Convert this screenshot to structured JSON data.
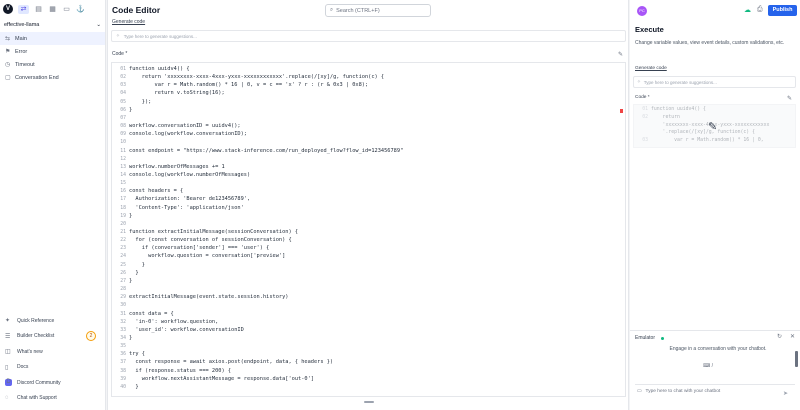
{
  "sidebar": {
    "logo": "V",
    "flow_name": "effective-llama",
    "flow_icon": "chevron-down-icon",
    "items": [
      {
        "label": "Main",
        "icon": "swap-icon",
        "active": true
      },
      {
        "label": "Error",
        "icon": "flag-icon",
        "active": false
      },
      {
        "label": "Timeout",
        "icon": "clock-icon",
        "active": false
      },
      {
        "label": "Conversation End",
        "icon": "stop-icon",
        "active": false
      }
    ],
    "bottom": [
      {
        "label": "Quick Reference",
        "icon": "lightbulb-icon"
      },
      {
        "label": "Builder Checklist",
        "icon": "checklist-icon",
        "badge": "2"
      },
      {
        "label": "What's new",
        "icon": "gift-icon"
      },
      {
        "label": "Docs",
        "icon": "book-icon"
      },
      {
        "label": "Discord Community",
        "icon": "discord-icon"
      },
      {
        "label": "Chat with Support",
        "icon": "chat-icon"
      }
    ]
  },
  "editor": {
    "title": "Code Editor",
    "search_placeholder": "Search (CTRL+F)",
    "generate_label": "Generate code",
    "generate_placeholder": "Type here to generate suggestions...",
    "code_label": "Code *",
    "lines": [
      {
        "n": "01",
        "t": "function uuidv4() {"
      },
      {
        "n": "02",
        "t": "    return 'xxxxxxxx-xxxx-4xxx-yxxx-xxxxxxxxxxxx'.replace(/[xy]/g, function(c) {"
      },
      {
        "n": "03",
        "t": "        var r = Math.random() * 16 | 0, v = c == 'x' ? r : (r & 0x3 | 0x8);"
      },
      {
        "n": "04",
        "t": "        return v.toString(16);"
      },
      {
        "n": "05",
        "t": "    });"
      },
      {
        "n": "06",
        "t": "}"
      },
      {
        "n": "07",
        "t": ""
      },
      {
        "n": "08",
        "t": "workflow.conversationID = uuidv4();"
      },
      {
        "n": "09",
        "t": "console.log(workflow.conversationID);"
      },
      {
        "n": "10",
        "t": ""
      },
      {
        "n": "11",
        "t": "const endpoint = \"https://www.stack-inference.com/run_deployed_flow?flow_id=123456789\""
      },
      {
        "n": "12",
        "t": ""
      },
      {
        "n": "13",
        "t": "workflow.numberOfMessages += 1"
      },
      {
        "n": "14",
        "t": "console.log(workflow.numberOfMessages)"
      },
      {
        "n": "15",
        "t": ""
      },
      {
        "n": "16",
        "t": "const headers = {"
      },
      {
        "n": "17",
        "t": "  Authorization: 'Bearer de123456789',"
      },
      {
        "n": "18",
        "t": "  'Content-Type': 'application/json'"
      },
      {
        "n": "19",
        "t": "}"
      },
      {
        "n": "20",
        "t": ""
      },
      {
        "n": "21",
        "t": "function extractInitialMessage(sessionConversation) {"
      },
      {
        "n": "22",
        "t": "  for (const conversation of sessionConversation) {"
      },
      {
        "n": "23",
        "t": "    if (conversation['sender'] === 'user') {"
      },
      {
        "n": "24",
        "t": "      workflow.question = conversation['preview']"
      },
      {
        "n": "25",
        "t": "    }"
      },
      {
        "n": "26",
        "t": "  }"
      },
      {
        "n": "27",
        "t": "}"
      },
      {
        "n": "28",
        "t": ""
      },
      {
        "n": "29",
        "t": "extractInitialMessage(event.state.session.history)"
      },
      {
        "n": "30",
        "t": ""
      },
      {
        "n": "31",
        "t": "const data = {"
      },
      {
        "n": "32",
        "t": "  'in-0': workflow.question,"
      },
      {
        "n": "33",
        "t": "  'user_id': workflow.conversationID"
      },
      {
        "n": "34",
        "t": "}"
      },
      {
        "n": "35",
        "t": ""
      },
      {
        "n": "36",
        "t": "try {"
      },
      {
        "n": "37",
        "t": "  const response = await axios.post(endpoint, data, { headers })"
      },
      {
        "n": "38",
        "t": "  if (response.status === 200) {"
      },
      {
        "n": "39",
        "t": "    workflow.nextAssistantMessage = response.data['out-0']"
      },
      {
        "n": "40",
        "t": "  }"
      }
    ]
  },
  "right": {
    "avatar": "PC",
    "publish_label": "Publish",
    "title": "Execute",
    "description": "Change variable values, view event details, custom validations, etc.",
    "generate_label": "Generate code",
    "generate_placeholder": "Type here to generate suggestions...",
    "code_label": "Code *",
    "code_lines": [
      {
        "n": "01",
        "t": "function uuidv4() {"
      },
      {
        "n": "02",
        "t": "    return"
      },
      {
        "n": "",
        "t": "    'xxxxxxxx-xxxx-4xxx-yxxx-xxxxxxxxxxxx"
      },
      {
        "n": "",
        "t": "    '.replace(/[xy]/g, function(c) {"
      },
      {
        "n": "03",
        "t": "        var r = Math.random() * 16 | 0,"
      }
    ],
    "emulator_label": "Emulator",
    "emulator_text": "Engage in a conversation with your chatbot.",
    "emulator_hint": "⌨ /",
    "chat_placeholder": "Type here to chat with your chatbot"
  }
}
